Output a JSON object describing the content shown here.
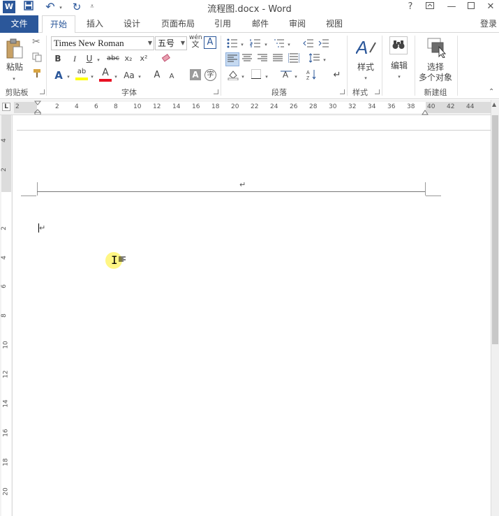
{
  "window": {
    "title": "流程图.docx - Word",
    "help": "?",
    "login": "登录"
  },
  "tabs": {
    "file": "文件",
    "items": [
      "开始",
      "插入",
      "设计",
      "页面布局",
      "引用",
      "邮件",
      "审阅",
      "视图"
    ],
    "active": "开始"
  },
  "clipboard": {
    "paste": "粘贴",
    "group": "剪贴板"
  },
  "font": {
    "name": "Times New Roman",
    "size": "五号",
    "wen": "wén",
    "wen_char": "文",
    "A_box": "A",
    "bold": "B",
    "italic": "I",
    "underline": "U",
    "strike": "abc",
    "sub": "x₂",
    "sup": "x²",
    "aa": "Aa",
    "grow": "A",
    "shrink": "A",
    "zi": "字",
    "group": "字体"
  },
  "paragraph": {
    "group": "段落",
    "mark": "↵"
  },
  "styles": {
    "label": "样式",
    "group": "样式"
  },
  "editing": {
    "label": "编辑"
  },
  "newgroup": {
    "label1": "选择",
    "label2": "多个对象",
    "group": "新建组"
  },
  "ruler": {
    "h": [
      "2",
      "2",
      "4",
      "6",
      "8",
      "10",
      "12",
      "14",
      "16",
      "18",
      "20",
      "22",
      "24",
      "26",
      "28",
      "30",
      "32",
      "34",
      "36",
      "38",
      "40",
      "42",
      "44"
    ],
    "v": [
      "4",
      "2",
      "2",
      "4",
      "6",
      "8",
      "10",
      "12",
      "14",
      "16",
      "18",
      "20"
    ],
    "tab_marker": "L"
  },
  "document": {
    "header_mark": "↵",
    "para_mark": "↵"
  },
  "colors": {
    "accent": "#2b579a",
    "highlight": "#ffff00",
    "font_red": "#e81123"
  }
}
